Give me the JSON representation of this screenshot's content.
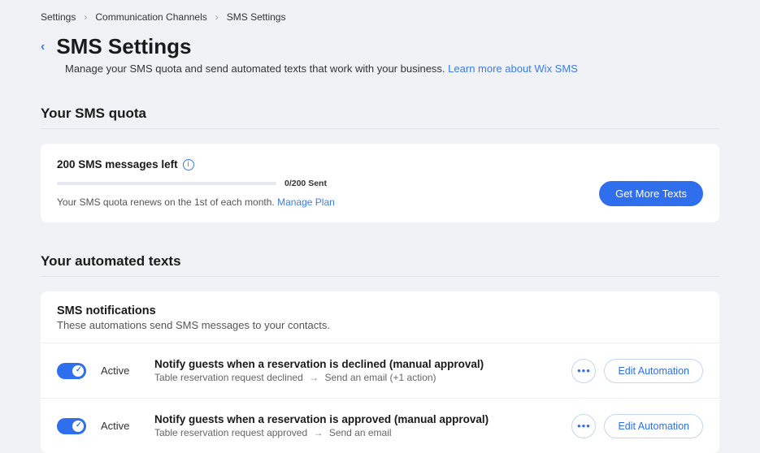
{
  "breadcrumb": {
    "items": [
      "Settings",
      "Communication Channels",
      "SMS Settings"
    ]
  },
  "header": {
    "title": "SMS Settings",
    "subtitle": "Manage your SMS quota and send automated texts that work with your business.",
    "learn_more": "Learn more about Wix SMS"
  },
  "quota_section": {
    "heading": "Your SMS quota",
    "remaining_label": "200 SMS messages left",
    "sent_label": "0/200 Sent",
    "renew_text": "Your SMS quota renews on the 1st of each month.",
    "manage_plan": "Manage Plan",
    "cta": "Get More Texts"
  },
  "automated_section": {
    "heading": "Your automated texts",
    "sub_heading": "SMS notifications",
    "sub_desc": "These automations send SMS messages to your contacts.",
    "status_active": "Active",
    "edit_label": "Edit Automation",
    "items": [
      {
        "title": "Notify guests when a reservation is declined (manual approval)",
        "trigger": "Table reservation request declined",
        "action": "Send an email (+1 action)"
      },
      {
        "title": "Notify guests when a reservation is approved (manual approval)",
        "trigger": "Table reservation request approved",
        "action": "Send an email"
      }
    ]
  }
}
